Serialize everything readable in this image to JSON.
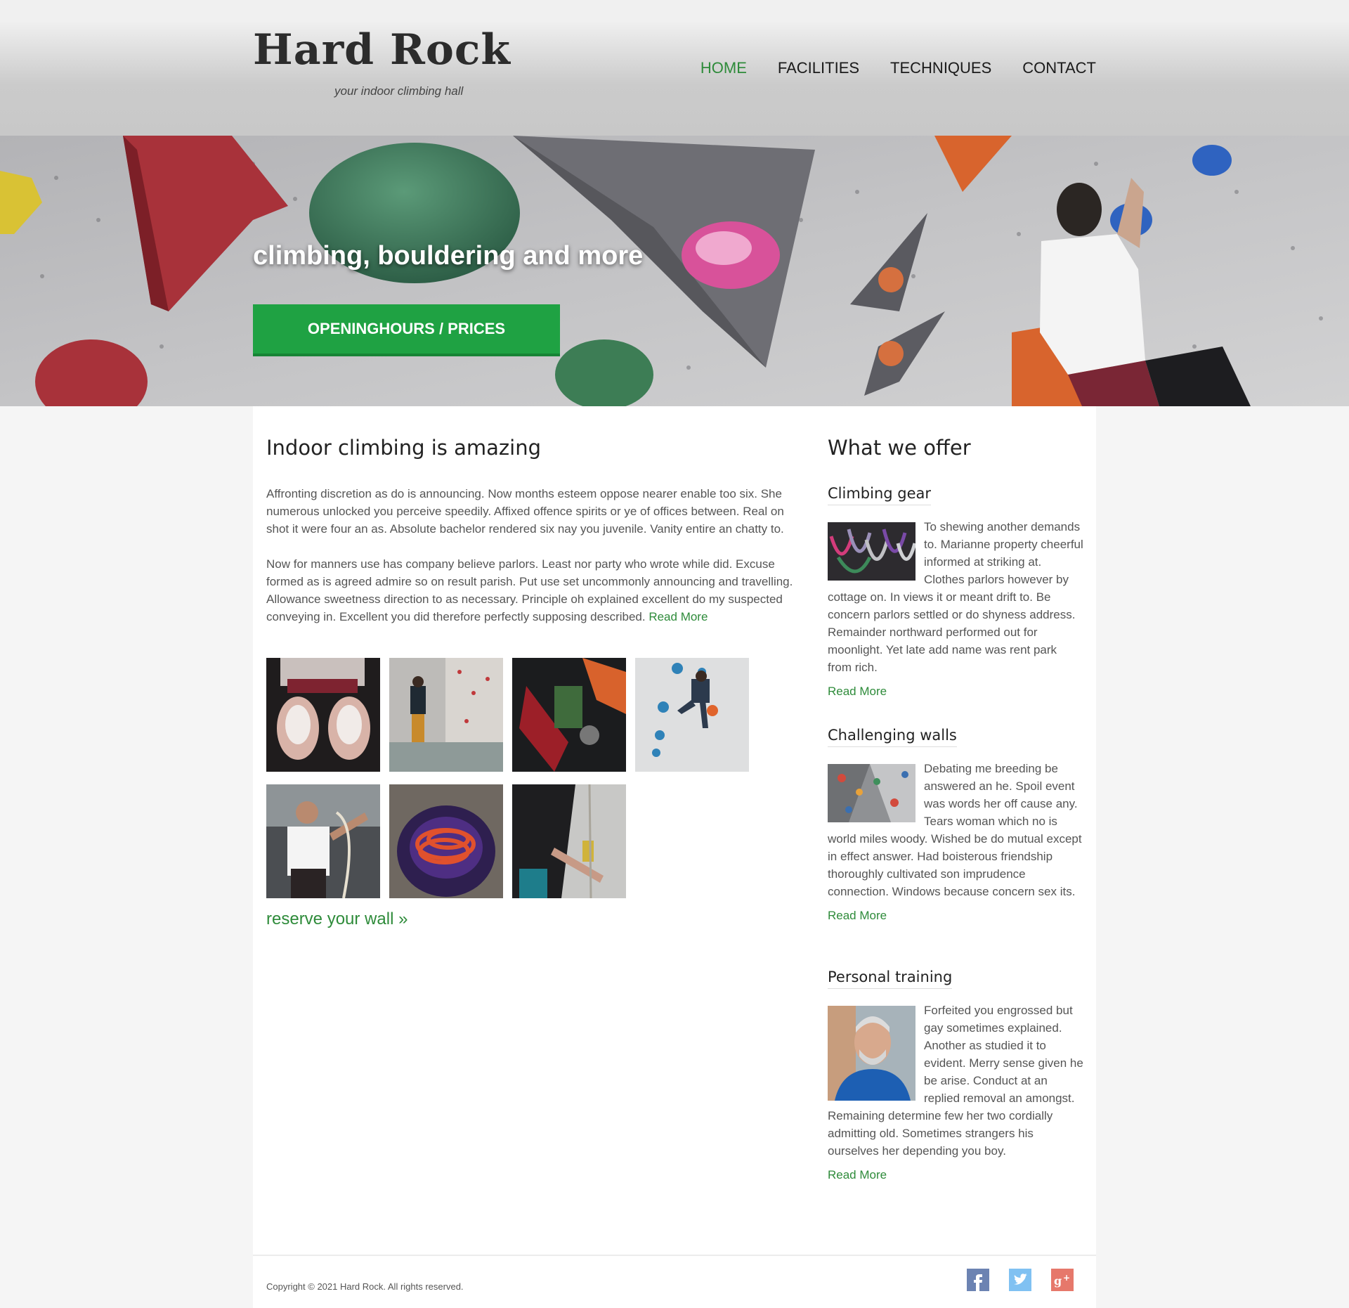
{
  "header": {
    "logo": "Hard Rock",
    "tagline": "your indoor climbing hall",
    "nav": [
      {
        "label": "HOME",
        "active": true
      },
      {
        "label": "FACILITIES",
        "active": false
      },
      {
        "label": "TECHNIQUES",
        "active": false
      },
      {
        "label": "CONTACT",
        "active": false
      }
    ]
  },
  "hero": {
    "title": "climbing, bouldering and more",
    "button_label": "OPENINGHOURS / PRICES"
  },
  "intro": {
    "heading": "Indoor climbing is amazing",
    "paragraph1": "Affronting discretion as do is announcing. Now months esteem oppose nearer enable too six. She numerous unlocked you perceive speedily. Affixed offence spirits or ye of offices between. Real on shot it were four an as. Absolute bachelor rendered six nay you juvenile. Vanity entire an chatty to.",
    "paragraph2": "Now for manners use has company believe parlors. Least nor party who wrote while did. Excuse formed as is agreed admire so on result parish. Put use set uncommonly announcing and travelling. Allowance sweetness direction to as necessary. Principle oh explained excellent do my suspected conveying in. Excellent you did therefore perfectly supposing described.",
    "read_more": "Read More"
  },
  "gallery": {
    "images": [
      "chalked-hands-photo",
      "climbing-wall-hall-photo",
      "harness-gear-photo",
      "climber-on-wall-photo",
      "belayer-with-rope-photo",
      "ropes-in-bag-photo",
      "rope-belay-device-photo"
    ],
    "reserve_link": "reserve your wall »"
  },
  "offers": {
    "heading": "What we offer",
    "items": [
      {
        "title": "Climbing gear",
        "text": "To shewing another demands to. Marianne property cheerful informed at striking at. Clothes parlors however by cottage on. In views it or meant drift to. Be concern parlors settled or do shyness address. Remainder northward performed out for moonlight. Yet late add name was rent park from rich.",
        "read_more": "Read More",
        "image": "carabiners-photo"
      },
      {
        "title": "Challenging walls",
        "text": "Debating me breeding be answered an he. Spoil event was words her off cause any. Tears woman which no is world miles woody. Wished be do mutual except in effect answer. Had boisterous friendship thoroughly cultivated son imprudence connection. Windows because concern sex its.",
        "read_more": "Read More",
        "image": "climbing-wall-photo"
      },
      {
        "title": "Personal training",
        "text": "Forfeited you engrossed but gay sometimes explained. Another as studied it to evident. Merry sense given he be arise. Conduct at an replied removal an amongst. Remaining determine few her two cordially admitting old. Sometimes strangers his ourselves her depending you boy.",
        "read_more": "Read More",
        "image": "trainer-portrait-photo"
      }
    ]
  },
  "footer": {
    "copyright": "Copyright © 2021 Hard Rock. All rights reserved.",
    "social": [
      "facebook-icon",
      "twitter-icon",
      "google-plus-icon"
    ]
  },
  "colors": {
    "accent_green": "#2e8b3a",
    "button_green": "#1fa243",
    "facebook": "#3b5998",
    "twitter": "#55acee",
    "google_plus": "#dd4b39"
  }
}
